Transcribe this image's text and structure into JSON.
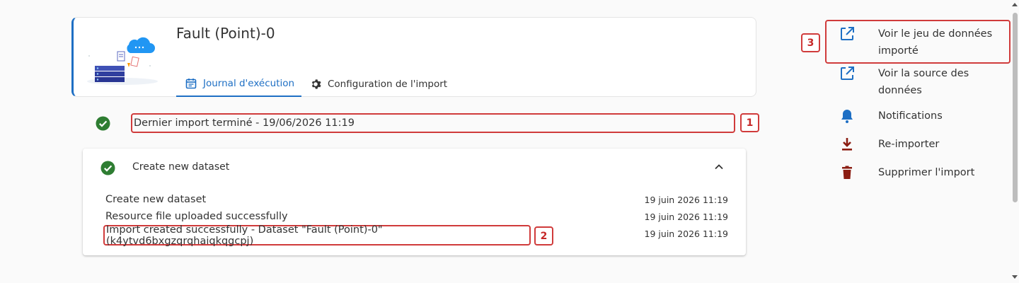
{
  "header": {
    "dataset_title": "Fault (Point)-0",
    "tabs": [
      {
        "label": "Journal d'exécution",
        "icon": "calendar-icon",
        "active": true
      },
      {
        "label": "Configuration de l'import",
        "icon": "gear-icon",
        "active": false
      }
    ]
  },
  "status": {
    "text": "Dernier import terminé - 19/06/2026 11:19",
    "icon": "check-circle-icon",
    "badge": "1"
  },
  "task": {
    "title": "Create new dataset",
    "icon": "check-circle-icon",
    "logs": [
      {
        "message": "Create new dataset",
        "time": "19 juin 2026 11:19"
      },
      {
        "message": "Resource file uploaded successfully",
        "time": "19 juin 2026 11:19"
      },
      {
        "message": "Import created successfully - Dataset \"Fault (Point)-0\" (k4ytvd6bxgzqrqhaiqkqgcpj)",
        "time": "19 juin 2026 11:19"
      }
    ],
    "badge": "2"
  },
  "actions": {
    "badge": "3",
    "items": [
      {
        "label": "Voir le jeu de données importé",
        "icon": "external-link-icon"
      },
      {
        "label": "Voir la source des données",
        "icon": "external-link-icon"
      },
      {
        "label": "Notifications",
        "icon": "bell-icon"
      },
      {
        "label": "Re-importer",
        "icon": "download-icon"
      },
      {
        "label": "Supprimer l'import",
        "icon": "trash-icon"
      }
    ]
  },
  "colors": {
    "primary": "#1e6fc4",
    "success": "#2e7d32",
    "danger": "#8b1d12",
    "highlight": "#d03b3b"
  }
}
